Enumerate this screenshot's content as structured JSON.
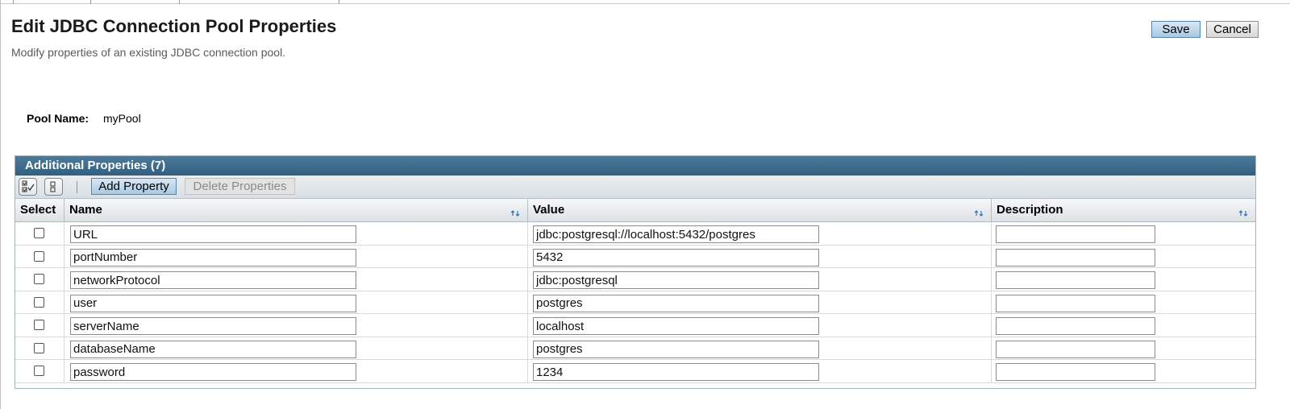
{
  "page": {
    "title": "Edit JDBC Connection Pool Properties",
    "help": "Modify properties of an existing JDBC connection pool.",
    "save_label": "Save",
    "cancel_label": "Cancel"
  },
  "pool": {
    "label": "Pool Name:",
    "value": "myPool"
  },
  "table": {
    "title": "Additional Properties (7)",
    "add_label": "Add Property",
    "delete_label": "Delete Properties",
    "columns": [
      "Select",
      "Name",
      "Value",
      "Description"
    ],
    "rows": [
      {
        "name": "URL",
        "value": "jdbc:postgresql://localhost:5432/postgres",
        "description": ""
      },
      {
        "name": "portNumber",
        "value": "5432",
        "description": ""
      },
      {
        "name": "networkProtocol",
        "value": "jdbc:postgresql",
        "description": ""
      },
      {
        "name": "user",
        "value": "postgres",
        "description": ""
      },
      {
        "name": "serverName",
        "value": "localhost",
        "description": ""
      },
      {
        "name": "databaseName",
        "value": "postgres",
        "description": ""
      },
      {
        "name": "password",
        "value": "1234",
        "description": ""
      }
    ]
  },
  "icons": {
    "select_all": "select-all-icon",
    "deselect_all": "deselect-all-icon",
    "sort": "sort-icon"
  },
  "colors": {
    "table_header": "#325f7f",
    "primary_button": "#a9c9e3"
  }
}
